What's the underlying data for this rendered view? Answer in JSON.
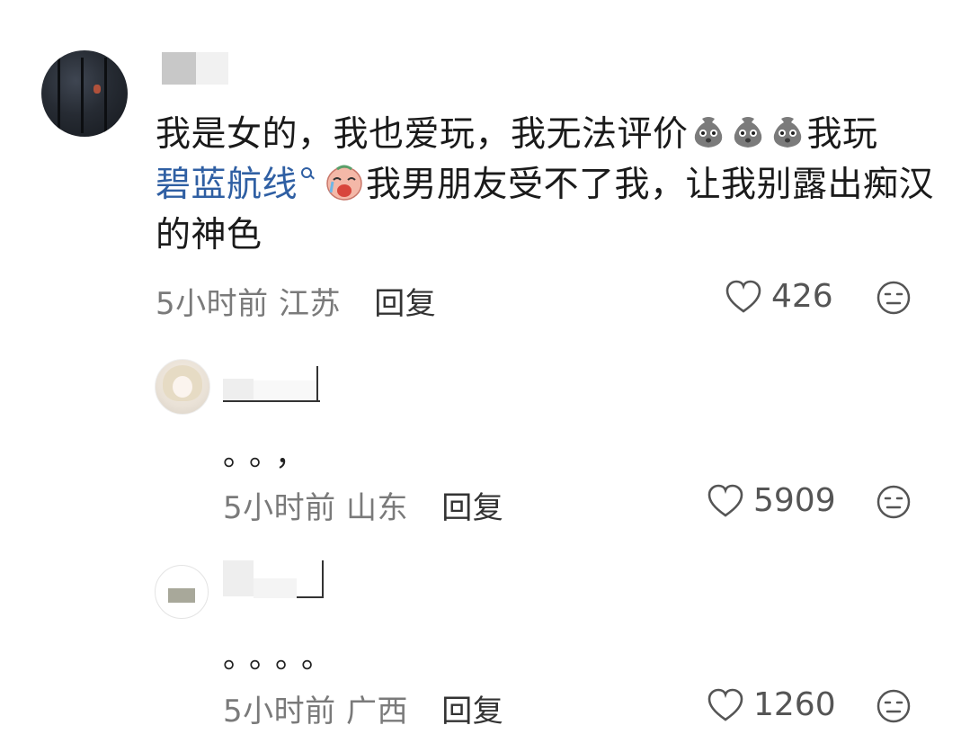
{
  "comments": [
    {
      "text_before_topic": "我是女的，我也爱玩，我无法评价",
      "emoji_1": "sack-face-emoji",
      "text_after_emojis": "我玩",
      "topic_link": "碧蓝航线",
      "emoji_2": "crying-face-emoji",
      "text_after_topic": "我男朋友受不了我，让我别露出痴汉的神色",
      "time": "5小时前",
      "location": "江苏",
      "reply_label": "回复",
      "likes": "426"
    },
    {
      "text": "。。，",
      "time": "5小时前",
      "location": "山东",
      "reply_label": "回复",
      "likes": "5909"
    },
    {
      "text": "。。。。",
      "time": "5小时前",
      "location": "广西",
      "reply_label": "回复",
      "likes": "1260"
    }
  ],
  "icons": {
    "like": "heart-outline-icon",
    "dislike": "neutral-face-icon",
    "topic_search": "search-icon"
  },
  "colors": {
    "topic_link": "#2f5fa3",
    "meta_text": "#7a7a7a"
  }
}
